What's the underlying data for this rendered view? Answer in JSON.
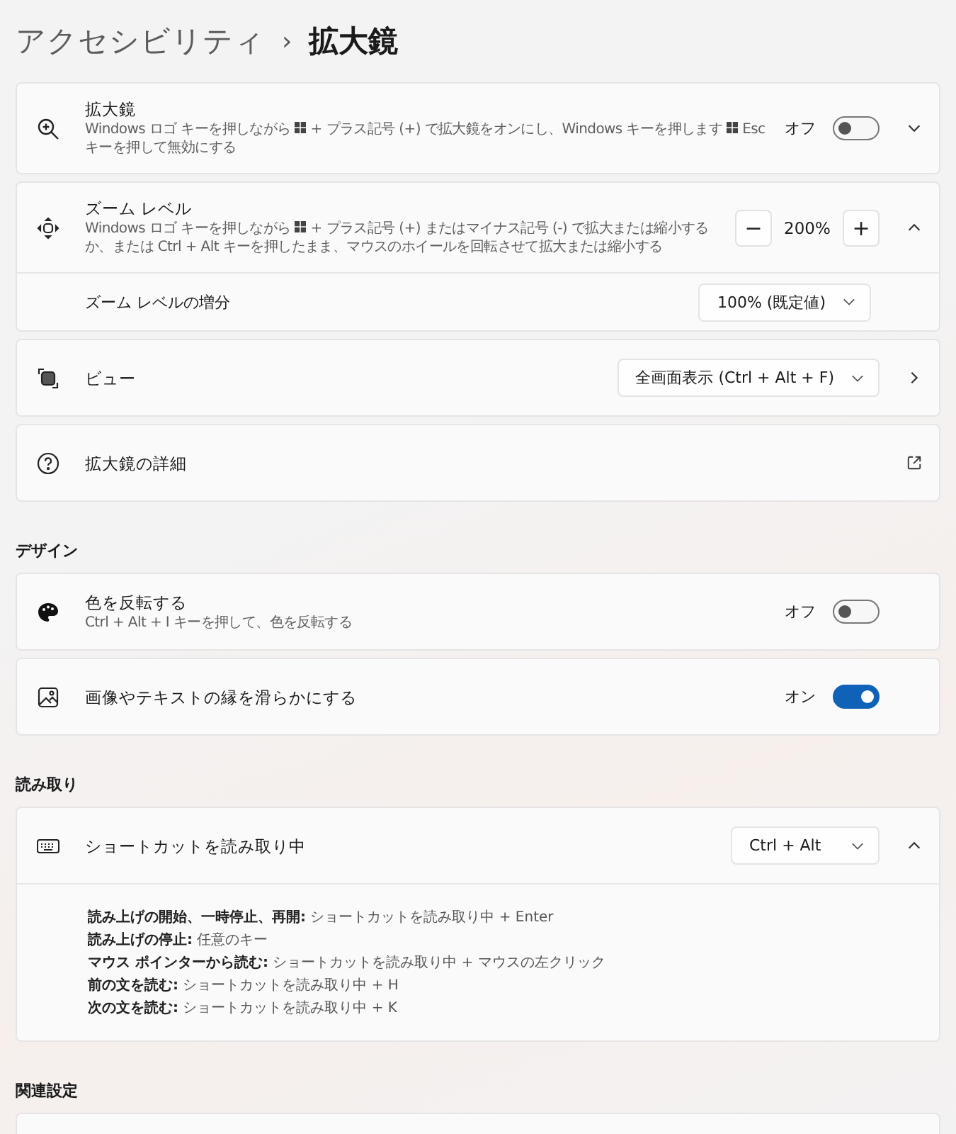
{
  "breadcrumb": {
    "parent": "アクセシビリティ",
    "separator": "›",
    "current": "拡大鏡"
  },
  "sections": [
    {
      "cards": [
        {
          "title": "拡大鏡",
          "description": [
            {
              "kind": "text",
              "text": "Windows ロゴ キーを押しながら"
            },
            {
              "kind": "winkey"
            },
            {
              "kind": "text",
              "text": "+ プラス記号 (+) で拡大鏡をオンにし、Windows キーを押します"
            },
            {
              "kind": "winkey"
            },
            {
              "kind": "text",
              "text": "Esc キーを押して無効にする"
            }
          ],
          "control": {
            "kind": "toggle",
            "on": false,
            "label": "オフ"
          },
          "expanded": false
        },
        {
          "title": "ズーム レベル",
          "description": [
            {
              "kind": "text",
              "text": "Windows ロゴ キーを押しながら"
            },
            {
              "kind": "winkey"
            },
            {
              "kind": "text",
              "text": "+ プラス記号 (+) またはマイナス記号 (-) で拡大または縮小するか、または Ctrl + Alt キーを押したまま、マウスのホイールを回転させて拡大または縮小する"
            }
          ],
          "control": {
            "kind": "stepper",
            "minus": "−",
            "value": "200%",
            "plus": "+"
          },
          "expanded": true,
          "subrows": [
            {
              "title": "ズーム レベルの増分",
              "control": {
                "kind": "dropdown",
                "value": "100% (既定値)"
              }
            }
          ]
        },
        {
          "title": "ビュー",
          "control": {
            "kind": "dropdown",
            "value": "全画面表示 (Ctrl + Alt + F)"
          }
        },
        {
          "title": "拡大鏡の詳細"
        }
      ]
    },
    {
      "heading": "デザイン",
      "cards": [
        {
          "title": "色を反転する",
          "description": [
            {
              "kind": "text",
              "text": "Ctrl + Alt + I キーを押して、色を反転する"
            }
          ],
          "control": {
            "kind": "toggle",
            "on": false,
            "label": "オフ"
          }
        },
        {
          "title": "画像やテキストの縁を滑らかにする",
          "control": {
            "kind": "toggle",
            "on": true,
            "label": "オン"
          }
        }
      ]
    },
    {
      "heading": "読み取り",
      "cards": [
        {
          "title": "ショートカットを読み取り中",
          "control": {
            "kind": "dropdown",
            "value": "Ctrl + Alt"
          },
          "expanded": true,
          "details": [
            "**読み上げの開始、一時停止、再開:** ショートカットを読み取り中 + Enter",
            "**読み上げの停止:** 任意のキー",
            "**マウス ポインターから読む:** ショートカットを読み取り中 + マウスの左クリック",
            "**前の文を読む:** ショートカットを読み取り中 + H",
            "**次の文を読む:** ショートカットを読み取り中 + K"
          ]
        }
      ]
    },
    {
      "heading": "関連設定"
    }
  ]
}
